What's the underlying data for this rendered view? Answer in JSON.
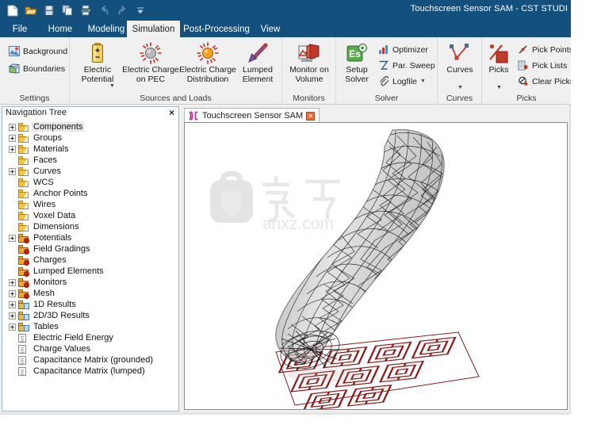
{
  "window": {
    "title": "Touchscreen Sensor SAM - CST STUDI",
    "accent_color": "#13507e",
    "ribbon_bg": "#f0f0f0"
  },
  "quick_access": [
    {
      "name": "new-icon",
      "label": "New"
    },
    {
      "name": "open-icon",
      "label": "Open"
    },
    {
      "name": "save-icon",
      "label": "Save"
    },
    {
      "name": "copy-icon",
      "label": "Copy"
    },
    {
      "name": "print-icon",
      "label": "Print"
    },
    {
      "name": "undo-icon",
      "label": "Undo"
    },
    {
      "name": "redo-icon",
      "label": "Redo"
    },
    {
      "name": "customize-qat-icon",
      "label": "Customize Quick Access Toolbar"
    }
  ],
  "tabs": [
    {
      "label": "File",
      "active": false
    },
    {
      "label": "Home",
      "active": false
    },
    {
      "label": "Modeling",
      "active": false
    },
    {
      "label": "Simulation",
      "active": true
    },
    {
      "label": "Post-Processing",
      "active": false
    },
    {
      "label": "View",
      "active": false
    }
  ],
  "ribbon": {
    "groups": [
      {
        "name": "settings",
        "label": "Settings",
        "small_buttons": [
          {
            "label": "Background",
            "icon": "background-icon"
          },
          {
            "label": "Boundaries",
            "icon": "boundaries-icon"
          }
        ],
        "big_buttons": []
      },
      {
        "name": "sources-and-loads",
        "label": "Sources and Loads",
        "small_buttons": [],
        "big_buttons": [
          {
            "label": "Electric\nPotential",
            "icon": "battery-icon",
            "has_dropdown": true
          },
          {
            "label": "Electric Charge\non PEC",
            "icon": "charge-pec-icon",
            "has_dropdown": false
          },
          {
            "label": "Electric Charge\nDistribution",
            "icon": "charge-distribution-icon",
            "has_dropdown": false
          },
          {
            "label": "Lumped\nElement",
            "icon": "lumped-element-icon",
            "has_dropdown": false
          }
        ]
      },
      {
        "name": "monitors",
        "label": "Monitors",
        "small_buttons": [],
        "big_buttons": [
          {
            "label": "Monitor on\nVolume",
            "icon": "monitor-volume-icon",
            "has_dropdown": false
          }
        ]
      },
      {
        "name": "solver",
        "label": "Solver",
        "small_buttons": [
          {
            "label": "Optimizer",
            "icon": "optimizer-icon"
          },
          {
            "label": "Par. Sweep",
            "icon": "par-sweep-icon"
          },
          {
            "label": "Logfile",
            "icon": "logfile-icon",
            "has_dropdown": true
          }
        ],
        "big_buttons": [
          {
            "label": "Setup\nSolver",
            "icon": "setup-solver-icon",
            "has_dropdown": false
          }
        ]
      },
      {
        "name": "curves",
        "label": "Curves",
        "small_buttons": [],
        "big_buttons": [
          {
            "label": "Curves",
            "icon": "curves-icon",
            "has_dropdown": true
          }
        ]
      },
      {
        "name": "picks",
        "label": "Picks",
        "small_buttons": [
          {
            "label": "Pick Points",
            "icon": "pick-points-icon",
            "has_dropdown": true
          },
          {
            "label": "Pick Lists",
            "icon": "pick-lists-icon",
            "has_dropdown": true
          },
          {
            "label": "Clear Picks",
            "icon": "clear-picks-icon"
          }
        ],
        "big_buttons": [
          {
            "label": "Picks",
            "icon": "picks-icon",
            "has_dropdown": true
          }
        ]
      }
    ]
  },
  "navigation_tree": {
    "title": "Navigation Tree",
    "close_label": "×",
    "items": [
      {
        "label": "Components",
        "icon": "folder-icon",
        "expandable": true,
        "selected": true
      },
      {
        "label": "Groups",
        "icon": "folder-icon",
        "expandable": true,
        "selected": false
      },
      {
        "label": "Materials",
        "icon": "folder-icon",
        "expandable": true,
        "selected": false
      },
      {
        "label": "Faces",
        "icon": "folder-icon",
        "expandable": false,
        "selected": false
      },
      {
        "label": "Curves",
        "icon": "folder-icon",
        "expandable": true,
        "selected": false
      },
      {
        "label": "WCS",
        "icon": "folder-icon",
        "expandable": false,
        "selected": false
      },
      {
        "label": "Anchor Points",
        "icon": "folder-icon",
        "expandable": false,
        "selected": false
      },
      {
        "label": "Wires",
        "icon": "folder-icon",
        "expandable": false,
        "selected": false
      },
      {
        "label": "Voxel Data",
        "icon": "folder-icon",
        "expandable": false,
        "selected": false
      },
      {
        "label": "Dimensions",
        "icon": "folder-icon",
        "expandable": false,
        "selected": false
      },
      {
        "label": "Potentials",
        "icon": "folder-gear-icon",
        "expandable": true,
        "selected": false
      },
      {
        "label": "Field Gradings",
        "icon": "folder-gear-icon",
        "expandable": false,
        "selected": false
      },
      {
        "label": "Charges",
        "icon": "folder-gear-icon",
        "expandable": false,
        "selected": false
      },
      {
        "label": "Lumped Elements",
        "icon": "folder-gear-icon",
        "expandable": false,
        "selected": false
      },
      {
        "label": "Monitors",
        "icon": "folder-gear-icon",
        "expandable": true,
        "selected": false
      },
      {
        "label": "Mesh",
        "icon": "folder-gear-icon",
        "expandable": true,
        "selected": false
      },
      {
        "label": "1D Results",
        "icon": "folder-result-icon",
        "expandable": true,
        "selected": false
      },
      {
        "label": "2D/3D Results",
        "icon": "folder-result-icon",
        "expandable": true,
        "selected": false
      },
      {
        "label": "Tables",
        "icon": "folder-result-icon",
        "expandable": true,
        "selected": false
      },
      {
        "label": "Electric Field Energy",
        "icon": "table-sheet-icon",
        "expandable": false,
        "selected": false
      },
      {
        "label": "Charge Values",
        "icon": "table-sheet-icon",
        "expandable": false,
        "selected": false
      },
      {
        "label": "Capacitance Matrix (grounded)",
        "icon": "table-sheet-icon",
        "expandable": false,
        "selected": false
      },
      {
        "label": "Capacitance Matrix (lumped)",
        "icon": "table-sheet-icon",
        "expandable": false,
        "selected": false
      }
    ]
  },
  "document": {
    "tab_label": "Touchscreen Sensor SAM",
    "tab_close_label": "×",
    "tab_icon": "cst-project-icon"
  },
  "viewport": {
    "background": "#ffffff",
    "model_description": "wireframe tetrahedral mesh of a SAM phantom finger/arm touching a sensor",
    "mesh_color": "#222222",
    "sensor_color": "#8b1a1a",
    "watermark_text": "anxz.com",
    "watermark_cjk": "安下载"
  }
}
